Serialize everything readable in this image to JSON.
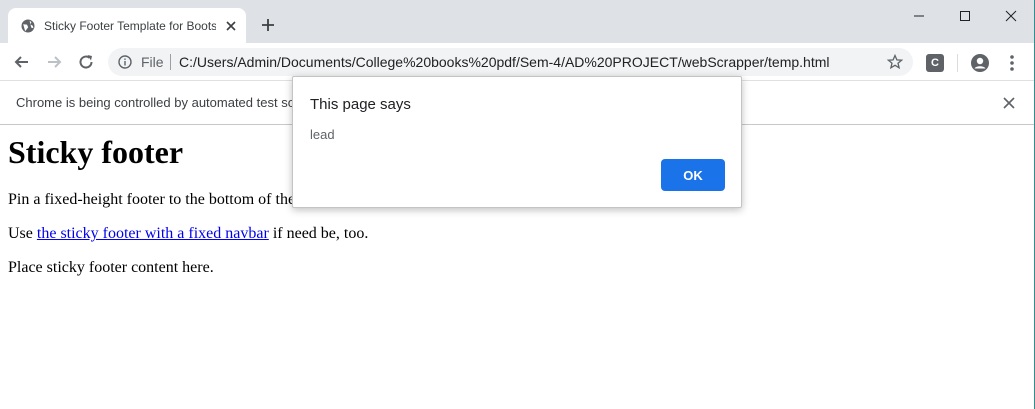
{
  "tab": {
    "title": "Sticky Footer Template for Bootstrap",
    "favicon_icon": "globe-icon",
    "close_icon": "close-icon"
  },
  "window_controls": [
    "minimize-icon",
    "maximize-icon",
    "close-icon"
  ],
  "toolbar": {
    "back_icon": "arrow-left-icon",
    "forward_icon": "arrow-right-icon",
    "reload_icon": "reload-icon",
    "site_info_icon": "info-icon",
    "scheme_label": "File",
    "url": "C:/Users/Admin/Documents/College%20books%20pdf/Sem-4/AD%20PROJECT/webScrapper/temp.html",
    "bookmark_icon": "star-icon",
    "extension_label": "C",
    "profile_icon": "account-icon",
    "menu_icon": "kebab-menu-icon"
  },
  "infobar": {
    "message": "Chrome is being controlled by automated test software."
  },
  "page": {
    "heading": "Sticky footer",
    "lead_text": "Pin a fixed-height footer to the bottom of the viewport in desktop browsers with this custom HTML and CSS.",
    "use_prefix": "Use ",
    "use_link": "the sticky footer with a fixed navbar",
    "use_suffix": " if need be, too.",
    "footer_text": "Place sticky footer content here."
  },
  "dialog": {
    "title": "This page says",
    "message": "lead",
    "ok_label": "OK"
  },
  "colors": {
    "accent": "#1a73e8",
    "tabstrip": "#dee1e6",
    "link": "#0000ee"
  }
}
